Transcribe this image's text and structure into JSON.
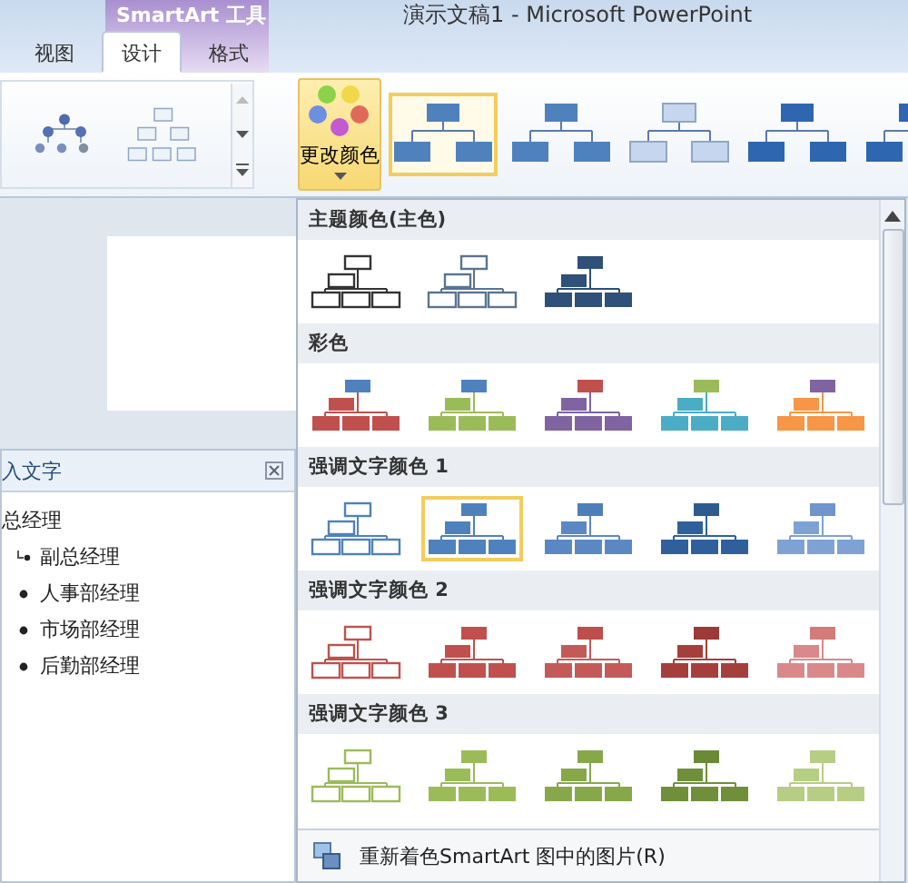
{
  "window": {
    "title": "演示文稿1 - Microsoft PowerPoint"
  },
  "contextual_tab_group": {
    "label": "SmartArt 工具"
  },
  "tabs": [
    {
      "label": "视图",
      "selected": false
    },
    {
      "label": "设计",
      "selected": true
    },
    {
      "label": "格式",
      "selected": false
    }
  ],
  "change_colors_button": {
    "label": "更改颜色"
  },
  "styles": [
    {
      "kind": "flat",
      "selected": true
    },
    {
      "kind": "subtle",
      "selected": false
    },
    {
      "kind": "gradient",
      "selected": false
    },
    {
      "kind": "dark",
      "selected": false
    },
    {
      "kind": "dark",
      "selected": false
    }
  ],
  "text_pane": {
    "title": "入文字",
    "items": [
      {
        "text": "总经理",
        "children": [
          {
            "text": "副总经理",
            "kind": "assistant"
          },
          {
            "text": "人事部经理",
            "kind": "bullet"
          },
          {
            "text": "市场部经理",
            "kind": "bullet"
          },
          {
            "text": "后勤部经理",
            "kind": "bullet"
          }
        ]
      }
    ]
  },
  "color_menu": {
    "sections": [
      {
        "title": "主题颜色(主色)",
        "options": [
          {
            "kind": "outline",
            "color": "#333333",
            "top": {
              "color": "#333333"
            },
            "selected": false
          },
          {
            "kind": "outline",
            "color": "#5a7491",
            "top": {
              "color": "#5a7491"
            },
            "selected": false
          },
          {
            "kind": "filled",
            "color": "#2e5079",
            "top": {
              "color": "#2e5079"
            },
            "selected": false
          }
        ]
      },
      {
        "title": "彩色",
        "options": [
          {
            "kind": "filled",
            "color": "#c0504d",
            "top": {
              "color": "#4f81bd"
            },
            "selected": false
          },
          {
            "kind": "filled",
            "color": "#9bbb59",
            "top": {
              "color": "#4f81bd"
            },
            "selected": false
          },
          {
            "kind": "filled",
            "color": "#8064a2",
            "top": {
              "color": "#c0504d"
            },
            "selected": false
          },
          {
            "kind": "filled",
            "color": "#4bacc6",
            "top": {
              "color": "#9bbb59"
            },
            "selected": false
          },
          {
            "kind": "filled",
            "color": "#f79646",
            "top": {
              "color": "#8064a2"
            },
            "selected": false
          }
        ]
      },
      {
        "title": "强调文字颜色 1",
        "options": [
          {
            "kind": "outline",
            "color": "#4f81bd",
            "top": {
              "color": "#4f81bd"
            },
            "selected": false
          },
          {
            "kind": "filled",
            "color": "#4f81bd",
            "top": {
              "color": "#4f81bd"
            },
            "selected": true
          },
          {
            "kind": "filled",
            "color": "#5b88c2",
            "top": {
              "color": "#4f7fbb"
            },
            "selected": false
          },
          {
            "kind": "filled",
            "color": "#30609c",
            "top": {
              "color": "#2d5a8f"
            },
            "selected": false
          },
          {
            "kind": "filled",
            "color": "#7ea2d4",
            "top": {
              "color": "#6f95cc"
            },
            "selected": false
          }
        ]
      },
      {
        "title": "强调文字颜色 2",
        "options": [
          {
            "kind": "outline",
            "color": "#c0504d",
            "top": {
              "color": "#c0504d"
            },
            "selected": false
          },
          {
            "kind": "filled",
            "color": "#c0504d",
            "top": {
              "color": "#c0504d"
            },
            "selected": false
          },
          {
            "kind": "filled",
            "color": "#c45a57",
            "top": {
              "color": "#bd4e4b"
            },
            "selected": false
          },
          {
            "kind": "filled",
            "color": "#a53f3c",
            "top": {
              "color": "#9c3a37"
            },
            "selected": false
          },
          {
            "kind": "filled",
            "color": "#d9898a",
            "top": {
              "color": "#d27b79"
            },
            "selected": false
          }
        ]
      },
      {
        "title": "强调文字颜色 3",
        "options": [
          {
            "kind": "outline",
            "color": "#9bbb59",
            "top": {
              "color": "#9bbb59"
            },
            "selected": false
          },
          {
            "kind": "filled",
            "color": "#9bbb59",
            "top": {
              "color": "#9bbb59"
            },
            "selected": false
          },
          {
            "kind": "filled",
            "color": "#87a84a",
            "top": {
              "color": "#87a84a"
            },
            "selected": false
          },
          {
            "kind": "filled",
            "color": "#6f8f3a",
            "top": {
              "color": "#6a8a36"
            },
            "selected": false
          },
          {
            "kind": "filled",
            "color": "#b6ce84",
            "top": {
              "color": "#b6ce84"
            },
            "selected": false
          }
        ]
      }
    ],
    "footer": {
      "label": "重新着色SmartArt 图中的图片(R)"
    }
  }
}
